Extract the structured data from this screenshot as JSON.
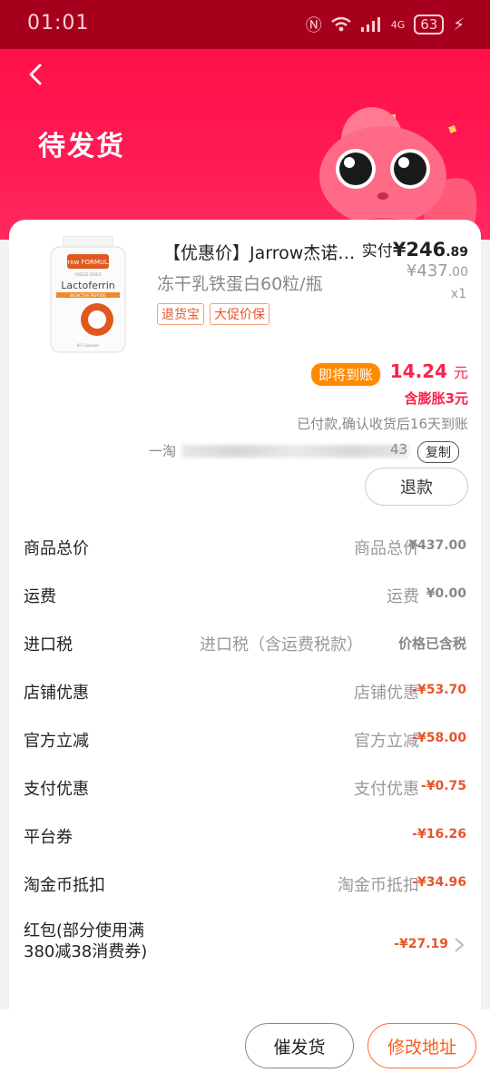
{
  "status_bar": {
    "time": "01:01",
    "battery": "63",
    "signal_label": "4G"
  },
  "header": {
    "title": "待发货"
  },
  "product": {
    "name": "【优惠价】Jarrow杰诺…",
    "subtitle": "冻干乳铁蛋白60粒/瓶",
    "paid_prefix": "实付",
    "paid_currency": "¥",
    "paid_main": "246",
    "paid_decimal": ".89",
    "original_currency": "¥",
    "original_main": "437",
    "original_decimal": ".00",
    "quantity": "x1",
    "tags": [
      "退货宝",
      "大促价保"
    ],
    "image_text": {
      "brand": "Jarrow FORMULAS",
      "freeze": "FREEZE DRIED",
      "title": "Lactoferrin",
      "band": "BIOACTIVE PEPTIDE",
      "count": "60 Capsules"
    }
  },
  "arrival": {
    "badge": "即将到账",
    "amount": "14.24",
    "unit": "元",
    "inflate": "含膨胀3元",
    "note": "已付款,确认收货后16天到账"
  },
  "order": {
    "prefix": "一淘",
    "suffix": "43",
    "copy_label": "复制"
  },
  "refund_label": "退款",
  "rows": [
    {
      "label": "商品总价",
      "mid": "商品总价",
      "value": "¥437.00",
      "tone": "gray"
    },
    {
      "label": "运费",
      "mid": "运费",
      "value": "¥0.00",
      "tone": "gray"
    },
    {
      "label": "进口税",
      "mid": "进口税（含运费税款）",
      "value": "价格已含税",
      "tone": "gray"
    },
    {
      "label": "店铺优惠",
      "mid": "店铺优惠",
      "value": "-¥53.70",
      "tone": "red"
    },
    {
      "label": "官方立减",
      "mid": "官方立减",
      "value": "-¥58.00",
      "tone": "red"
    },
    {
      "label": "支付优惠",
      "mid": "支付优惠",
      "value": "-¥0.75",
      "tone": "red"
    },
    {
      "label": "平台券",
      "mid": "",
      "value": "-¥16.26",
      "tone": "red"
    },
    {
      "label": "淘金币抵扣",
      "mid": "淘金币抵扣",
      "value": "-¥34.96",
      "tone": "red"
    },
    {
      "label": "红包(部分使用满380减38消费券)",
      "mid": "",
      "value": "-¥27.19",
      "tone": "red"
    }
  ],
  "bottom": {
    "urge_label": "催发货",
    "address_label": "修改地址"
  },
  "colors": {
    "header": "#ff1148",
    "accent_red": "#ff1f4a",
    "orange": "#ff8a00",
    "discount": "#e8552a"
  }
}
